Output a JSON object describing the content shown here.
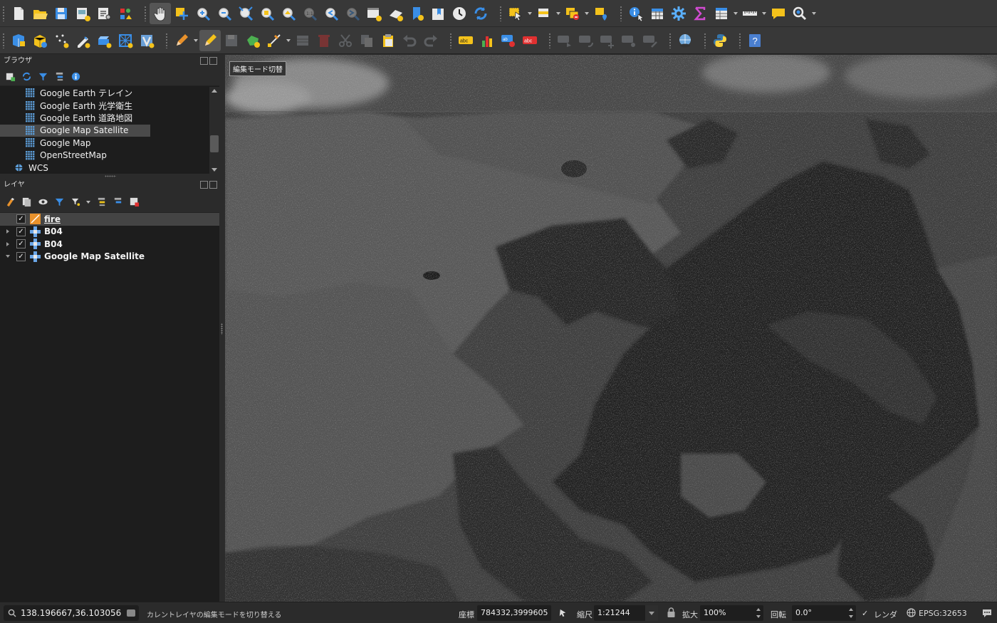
{
  "toolbar1": [
    {
      "name": "new-project-button",
      "icon": "new-document-icon"
    },
    {
      "name": "open-project-button",
      "icon": "folder-open-icon"
    },
    {
      "name": "save-project-button",
      "icon": "floppy-disk-icon"
    },
    {
      "name": "new-print-layout-button",
      "icon": "print-layout-icon"
    },
    {
      "name": "layout-manager-button",
      "icon": "layout-manager-icon"
    },
    {
      "name": "style-manager-button",
      "icon": "style-manager-icon"
    },
    {
      "name": "pan-map-button",
      "icon": "hand-pan-icon",
      "active": true
    },
    {
      "name": "pan-to-selection-button",
      "icon": "pan-to-selection-icon"
    },
    {
      "name": "zoom-in-button",
      "icon": "zoom-in-icon"
    },
    {
      "name": "zoom-out-button",
      "icon": "zoom-out-icon"
    },
    {
      "name": "zoom-full-button",
      "icon": "zoom-full-icon"
    },
    {
      "name": "zoom-to-selection-button",
      "icon": "zoom-selection-icon"
    },
    {
      "name": "zoom-to-layer-button",
      "icon": "zoom-layer-icon"
    },
    {
      "name": "zoom-native-button",
      "icon": "zoom-native-icon",
      "disabled": true
    },
    {
      "name": "zoom-last-button",
      "icon": "zoom-last-icon"
    },
    {
      "name": "zoom-next-button",
      "icon": "zoom-next-icon",
      "disabled": true
    },
    {
      "name": "new-map-view-button",
      "icon": "new-map-view-icon"
    },
    {
      "name": "new-3d-map-view-button",
      "icon": "new-3d-map-icon"
    },
    {
      "name": "new-bookmark-button",
      "icon": "bookmark-icon"
    },
    {
      "name": "show-bookmarks-button",
      "icon": "bookmarks-book-icon"
    },
    {
      "name": "temporal-controller-button",
      "icon": "clock-icon"
    },
    {
      "name": "refresh-button",
      "icon": "refresh-icon"
    },
    {
      "name": "select-features-button",
      "icon": "select-features-icon",
      "dropdown": true
    },
    {
      "name": "select-by-value-button",
      "icon": "select-value-icon",
      "dropdown": true
    },
    {
      "name": "deselect-features-button",
      "icon": "deselect-icon",
      "dropdown": true
    },
    {
      "name": "select-location-button",
      "icon": "select-location-icon"
    },
    {
      "name": "identify-features-button",
      "icon": "identify-icon"
    },
    {
      "name": "attribute-table-button",
      "icon": "attribute-table-icon"
    },
    {
      "name": "processing-toolbox-button",
      "icon": "gear-icon"
    },
    {
      "name": "statistical-summary-button",
      "icon": "sigma-icon"
    },
    {
      "name": "open-table-button",
      "icon": "table-icon",
      "dropdown": true
    },
    {
      "name": "measure-line-button",
      "icon": "ruler-icon",
      "dropdown": true
    },
    {
      "name": "map-tips-button",
      "icon": "speech-bubble-icon"
    },
    {
      "name": "locator-settings-button",
      "icon": "search-settings-icon",
      "dropdown": true
    }
  ],
  "toolbar2": [
    {
      "name": "data-source-manager-button",
      "icon": "data-source-manager-icon"
    },
    {
      "name": "new-geopackage-layer-button",
      "icon": "geopackage-icon"
    },
    {
      "name": "new-temp-scratch-layer-button",
      "icon": "scratch-layer-icon"
    },
    {
      "name": "new-shapefile-layer-button",
      "icon": "new-shapefile-icon"
    },
    {
      "name": "new-spatialite-layer-button",
      "icon": "spatialite-icon"
    },
    {
      "name": "new-mesh-layer-button",
      "icon": "mesh-layer-icon"
    },
    {
      "name": "new-virtual-layer-button",
      "icon": "virtual-layer-icon"
    },
    {
      "name": "current-edits-button",
      "icon": "pencil-edits-icon",
      "dropdown": true
    },
    {
      "name": "toggle-editing-button",
      "icon": "pencil-icon",
      "active": true
    },
    {
      "name": "save-layer-edits-button",
      "icon": "save-edits-icon",
      "disabled": true
    },
    {
      "name": "add-polygon-button",
      "icon": "add-polygon-icon"
    },
    {
      "name": "digitize-tool-button",
      "icon": "vertex-tool-icon",
      "dropdown": true
    },
    {
      "name": "modify-attributes-button",
      "icon": "modify-attributes-icon",
      "disabled": true
    },
    {
      "name": "delete-selected-button",
      "icon": "trash-icon",
      "disabled": true
    },
    {
      "name": "cut-features-button",
      "icon": "scissors-icon",
      "disabled": true
    },
    {
      "name": "copy-features-button",
      "icon": "copy-icon",
      "disabled": true
    },
    {
      "name": "paste-features-button",
      "icon": "paste-icon"
    },
    {
      "name": "undo-button",
      "icon": "undo-icon",
      "disabled": true
    },
    {
      "name": "redo-button",
      "icon": "redo-icon",
      "disabled": true
    },
    {
      "name": "layer-labeling-button",
      "icon": "abc-label-yellow-icon"
    },
    {
      "name": "layer-diagram-button",
      "icon": "diagram-icon"
    },
    {
      "name": "pin-labels-button",
      "icon": "pin-label-icon"
    },
    {
      "name": "highlight-pinned-labels-button",
      "icon": "abc-label-red-icon"
    },
    {
      "name": "move-label-button",
      "icon": "move-label-icon",
      "disabled": true
    },
    {
      "name": "rotate-label-button",
      "icon": "rotate-label-icon",
      "disabled": true
    },
    {
      "name": "change-label-button",
      "icon": "change-label-icon",
      "disabled": true
    },
    {
      "name": "show-hide-labels-button",
      "icon": "show-label-icon",
      "disabled": true
    },
    {
      "name": "label-properties-button",
      "icon": "label-properties-icon",
      "disabled": true
    },
    {
      "name": "georeferencer-button",
      "icon": "globe-plugin-icon"
    },
    {
      "name": "python-console-button",
      "icon": "python-icon"
    },
    {
      "name": "help-button",
      "icon": "help-icon"
    }
  ],
  "browser": {
    "title": "ブラウザ",
    "items": [
      {
        "label": "Google Earth テレイン",
        "selected": false
      },
      {
        "label": "Google Earth 光学衛生",
        "selected": false
      },
      {
        "label": "Google Earth 道路地図",
        "selected": false
      },
      {
        "label": "Google Map Satellite",
        "selected": true
      },
      {
        "label": "Google Map",
        "selected": false
      },
      {
        "label": "OpenStreetMap",
        "selected": false
      }
    ],
    "wcs_label": "WCS"
  },
  "layers": {
    "title": "レイヤ",
    "items": [
      {
        "label": "fire",
        "type": "vector-polygon",
        "checked": true,
        "selected": true,
        "expander": "none",
        "editing": true
      },
      {
        "label": "B04",
        "type": "raster",
        "checked": true,
        "selected": false,
        "expander": "collapsed"
      },
      {
        "label": "B04",
        "type": "raster",
        "checked": true,
        "selected": false,
        "expander": "collapsed"
      },
      {
        "label": "Google Map Satellite",
        "type": "raster",
        "checked": true,
        "selected": false,
        "expander": "expanded"
      }
    ]
  },
  "map": {
    "tooltip": "編集モード切替"
  },
  "status": {
    "locator_value": "138.196667,36.103056",
    "message": "カレントレイヤの編集モードを切り替える",
    "coord_label": "座標",
    "coord_value": "784332,3999605",
    "scale_label": "縮尺",
    "scale_value": "1:21244",
    "magnifier_label": "拡大",
    "magnifier_value": "100%",
    "rotation_label": "回転",
    "rotation_value": "0.0°",
    "render_label": "レンダ",
    "render_checked": true,
    "crs_label": "EPSG:32653"
  },
  "colors": {
    "accent_yellow": "#f4c21b",
    "accent_blue": "#4a90d9",
    "edit_orange": "#e8912b"
  }
}
